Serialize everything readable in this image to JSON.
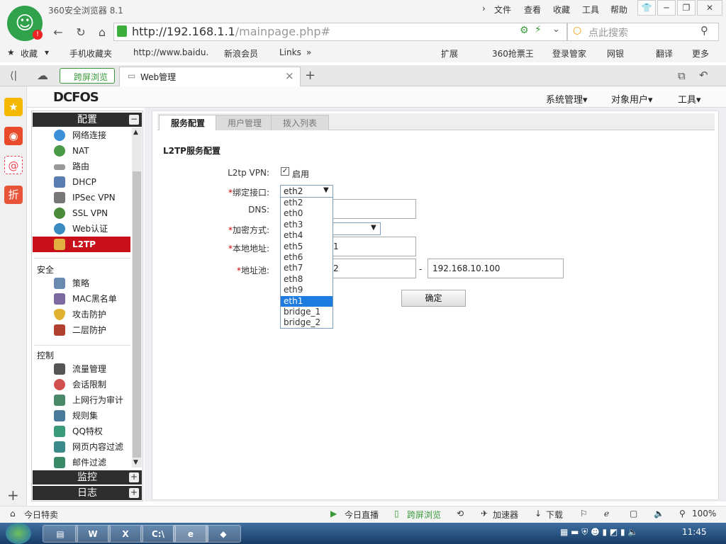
{
  "browser": {
    "app_title": "360安全浏览器 8.1",
    "menu": [
      "文件",
      "查看",
      "收藏",
      "工具",
      "帮助"
    ],
    "win_buttons": [
      "👕",
      "─",
      "❐",
      "✕"
    ],
    "url_host": "http://192.168.1.1",
    "url_path": "/mainpage.php#",
    "search_placeholder": "点此搜索",
    "bookmarks": [
      "收藏",
      "手机收藏夹",
      "http://www.baidu.",
      "新浪会员",
      "Links",
      "»"
    ],
    "bookmarks_right": [
      "扩展",
      "360抢票王",
      "登录管家",
      "网银",
      "翻译",
      "更多"
    ],
    "tabs": [
      {
        "label": "跨屏浏览"
      },
      {
        "label": "Web管理"
      }
    ],
    "tab_close": "×",
    "new_tab": "+"
  },
  "app": {
    "brand": "DCFOS",
    "header_menu": [
      "系统管理▾",
      "对象用户▾",
      "工具▾"
    ]
  },
  "sidebar": {
    "config_title": "配置",
    "config_items": [
      "网络连接",
      "NAT",
      "路由",
      "DHCP",
      "IPSec VPN",
      "SSL VPN",
      "Web认证",
      "L2TP"
    ],
    "security_title": "安全",
    "security_items": [
      "策略",
      "MAC黑名单",
      "攻击防护",
      "二层防护"
    ],
    "control_title": "控制",
    "control_items": [
      "流量管理",
      "会话限制",
      "上网行为审计",
      "规则集",
      "QQ特权",
      "网页内容过滤",
      "邮件过滤"
    ],
    "monitor_title": "监控",
    "log_title": "日志"
  },
  "content": {
    "tabs": [
      "服务配置",
      "用户管理",
      "拨入列表"
    ],
    "section_title": "L2TP服务配置",
    "fields": {
      "l2tp_vpn_label": "L2tp VPN:",
      "l2tp_vpn_checked_text": "启用",
      "bind_if_label": "绑定接口:",
      "bind_if_value": "eth2",
      "dns_label": "DNS:",
      "encrypt_label": "加密方式:",
      "local_addr_label": "本地地址:",
      "local_addr_value": "1",
      "pool_label": "地址池:",
      "pool_start_value": "2",
      "pool_sep": "-",
      "pool_end_value": "192.168.10.100"
    },
    "interface_options": [
      "eth2",
      "eth0",
      "eth3",
      "eth4",
      "eth5",
      "eth6",
      "eth7",
      "eth8",
      "eth9",
      "eth1",
      "bridge_1",
      "bridge_2"
    ],
    "highlighted_option": "eth1",
    "confirm_label": "确定"
  },
  "statusbar": {
    "left": "今日特卖",
    "items": [
      "今日直播",
      "跨屏浏览",
      "加速器",
      "下载"
    ],
    "zoom": "100%"
  },
  "taskbar": {
    "clock": "11:45"
  },
  "colors": {
    "accent_red": "#c8101a",
    "select_blue": "#1e7be0",
    "sidebar_header": "#2e2e2e"
  }
}
